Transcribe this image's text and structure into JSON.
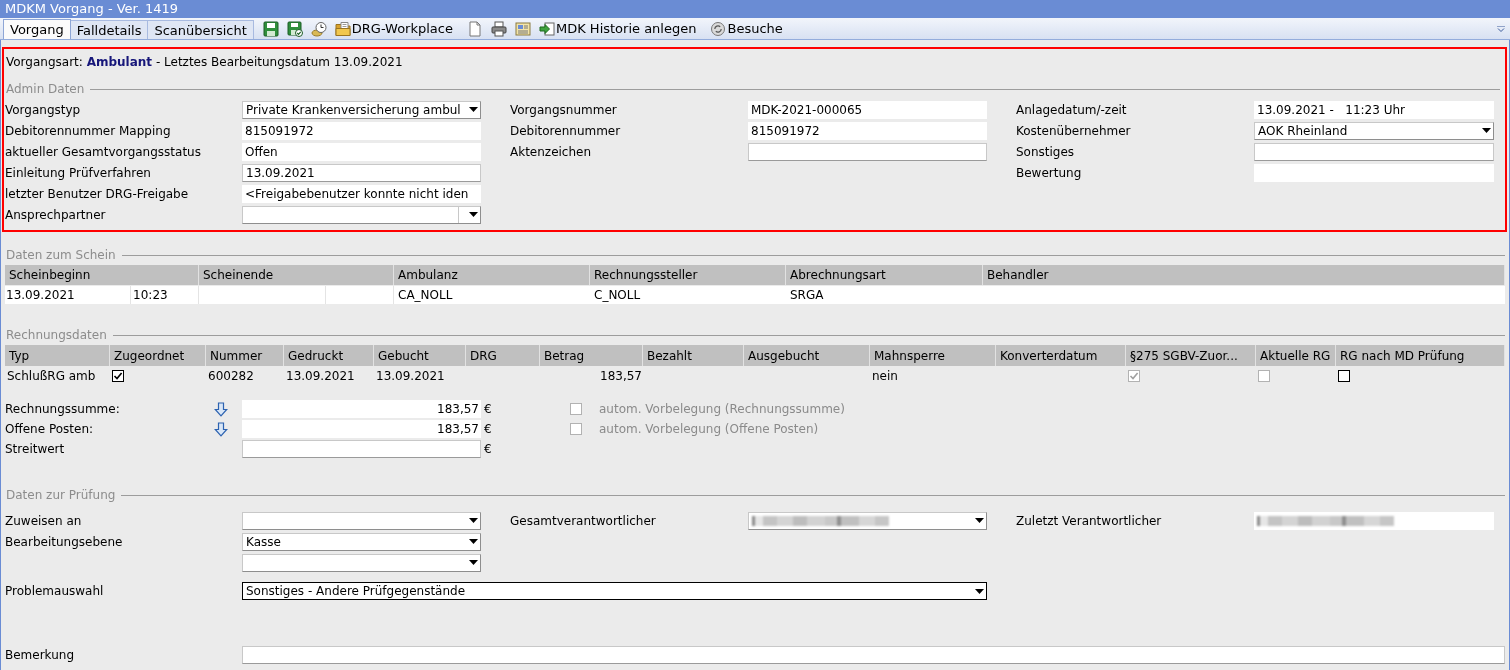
{
  "window": {
    "title": "MDKM Vorgang - Ver. 1419"
  },
  "tabs": [
    {
      "label": "Vorgang",
      "selected": true
    },
    {
      "label": "Falldetails",
      "selected": false
    },
    {
      "label": "Scanübersicht",
      "selected": false
    }
  ],
  "toolbar": {
    "buttons": [
      "DRG-Workplace",
      "MDK Historie anlegen",
      "Besuche"
    ]
  },
  "summary": "Vorgangsart: **Ambulant** - Letztes Bearbeitungsdatum 13.09.2021",
  "admin_daten": {
    "legend": "Admin Daten",
    "columns": [
      [
        {
          "label": "Vorgangstyp",
          "kind": "dropdown",
          "value": "Private Krankenversicherung ambul"
        },
        {
          "label": "Debitorennummer Mapping",
          "kind": "readonly",
          "value": "815091972"
        },
        {
          "label": "aktueller Gesamtvorgangsstatus",
          "kind": "readonly",
          "value": "Offen"
        },
        {
          "label": "Einleitung Prüfverfahren",
          "kind": "input",
          "value": "13.09.2021"
        },
        {
          "label": "letzter Benutzer DRG-Freigabe",
          "kind": "readonly",
          "value": "<Freigabebenutzer konnte nicht iden"
        },
        {
          "label": "Ansprechpartner",
          "kind": "combobox"
        }
      ],
      [
        {
          "label": "Vorgangsnummer",
          "kind": "readonly",
          "value": "MDK-2021-000065"
        },
        {
          "label": "Debitorennummer",
          "kind": "readonly",
          "value": "815091972"
        },
        {
          "label": "Aktenzeichen",
          "kind": "input"
        }
      ],
      [
        {
          "label": "Anlagedatum/-zeit",
          "kind": "readonly",
          "value": "13.09.2021 -   11:23 Uhr"
        },
        {
          "label": "Kostenübernehmer",
          "kind": "dropdown",
          "value": "AOK Rheinland"
        },
        {
          "label": "Sonstiges",
          "kind": "input"
        },
        {
          "label": "Bewertung",
          "kind": "readonly"
        }
      ]
    ]
  },
  "daten_zum_schein": {
    "legend": "Daten zum Schein",
    "columns": [
      {
        "label": "Scheinbeginn",
        "kind": "datetime"
      },
      {
        "label": "Scheinende",
        "kind": "datetime"
      },
      {
        "label": "Ambulanz",
        "kind": "text"
      },
      {
        "label": "Rechnungssteller",
        "kind": "text"
      },
      {
        "label": "Abrechnungsart",
        "kind": "text"
      },
      {
        "label": "Behandler",
        "kind": "text"
      }
    ],
    "rows": [
      {
        "cells": [
          {
            "date": "13.09.2021",
            "time": "10:23"
          },
          {},
          {
            "text": "CA_NOLL"
          },
          {
            "text": "C_NOLL"
          },
          {
            "text": "SRGA"
          },
          {}
        ]
      }
    ]
  },
  "rechnungsdaten": {
    "legend": "Rechnungsdaten",
    "columns": [
      "Typ",
      "Zugeordnet",
      "Nummer",
      "Gedruckt",
      "Gebucht",
      "DRG",
      "Betrag",
      "Bezahlt",
      "Ausgebucht",
      "Mahnsperre",
      "Konverterdatum",
      "§275 SGBV-Zuor...",
      "Aktuelle RG",
      "RG nach MD Prüfung"
    ],
    "rows": [
      {
        "cells": [
          {
            "kind": "text",
            "text": "SchlußRG amb"
          },
          {
            "kind": "checkbox",
            "checked": true,
            "disabled": false
          },
          {
            "kind": "text",
            "text": "600282"
          },
          {
            "kind": "text",
            "text": "13.09.2021"
          },
          {
            "kind": "text",
            "text": "13.09.2021"
          },
          {},
          {
            "kind": "amount",
            "text": "183,57"
          },
          {},
          {},
          {
            "kind": "text",
            "text": "nein"
          },
          {},
          {
            "kind": "checkbox",
            "checked": true,
            "disabled": true
          },
          {
            "kind": "checkbox",
            "checked": false,
            "disabled": true
          },
          {
            "kind": "checkbox",
            "checked": false,
            "disabled": false
          }
        ]
      }
    ],
    "totals": [
      {
        "label": "Rechnungssumme:",
        "arrow": true,
        "kind": "readonly",
        "value": "183,57",
        "currency": "€",
        "option": {
          "label": "autom. Vorbelegung (Rechnungssumme)",
          "checked": false,
          "disabled": true
        }
      },
      {
        "label": "Offene Posten:",
        "arrow": true,
        "kind": "readonly",
        "value": "183,57",
        "currency": "€",
        "option": {
          "label": "autom. Vorbelegung (Offene Posten)",
          "checked": false,
          "disabled": true
        }
      },
      {
        "label": "Streitwert",
        "arrow": false,
        "kind": "input",
        "currency": "€"
      }
    ]
  },
  "daten_zur_pruefung": {
    "legend": "Daten zur Prüfung",
    "columns": [
      [
        {
          "label": "Zuweisen an",
          "kind": "dropdown",
          "redacted": false
        },
        {
          "label": "Bearbeitungsebene",
          "kind": "dropdown",
          "value": "Kasse",
          "redacted": false
        },
        {
          "kind": "dropdown",
          "redacted": false
        }
      ],
      [
        {
          "label": "Gesamtverantwortlicher",
          "kind": "dropdown",
          "redacted": true
        }
      ],
      [
        {
          "label": "Zuletzt Verantwortlicher",
          "kind": "readonly",
          "redacted": true
        }
      ]
    ],
    "wide_fields": [
      {
        "label": "Problemauswahl",
        "kind": "dropdown",
        "value": "Sonstiges - Andere Prüfgegenstände",
        "focused": true
      },
      {
        "label": "Bemerkung",
        "kind": "input",
        "focused": false
      }
    ]
  }
}
